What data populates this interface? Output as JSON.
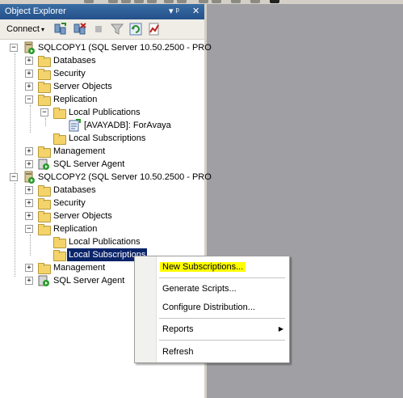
{
  "panel": {
    "title": "Object Explorer",
    "pin": "▾ ᵖ",
    "close": "✕"
  },
  "toolbar": {
    "connect_label": "Connect",
    "dropdown_arrow": "▾"
  },
  "tree": {
    "server1": {
      "label": "SQLCOPY1 (SQL Server 10.50.2500 - PRO",
      "expander": "−"
    },
    "s1_databases": "Databases",
    "s1_security": "Security",
    "s1_server_objects": "Server Objects",
    "s1_replication": "Replication",
    "s1_local_publications": "Local Publications",
    "s1_publication_item": "[AVAYADB]: ForAvaya",
    "s1_local_subscriptions": "Local Subscriptions",
    "s1_management": "Management",
    "s1_agent": "SQL Server Agent",
    "server2": {
      "label": "SQLCOPY2 (SQL Server 10.50.2500 - PRO",
      "expander": "−"
    },
    "s2_databases": "Databases",
    "s2_security": "Security",
    "s2_server_objects": "Server Objects",
    "s2_replication": "Replication",
    "s2_local_publications": "Local Publications",
    "s2_local_subscriptions": "Local Subscriptions",
    "s2_management": "Management",
    "s2_agent": "SQL Server Agent",
    "plus": "+",
    "minus": "−"
  },
  "context_menu": {
    "new_subscriptions": "New Subscriptions...",
    "generate_scripts": "Generate Scripts...",
    "configure_distribution": "Configure Distribution...",
    "reports": "Reports",
    "reports_arrow": "▶",
    "refresh": "Refresh"
  },
  "colors": {
    "titlebar": "#24508a",
    "selection": "#0a246a",
    "highlight": "#ffff00",
    "doc_area": "#a0a0a4"
  }
}
